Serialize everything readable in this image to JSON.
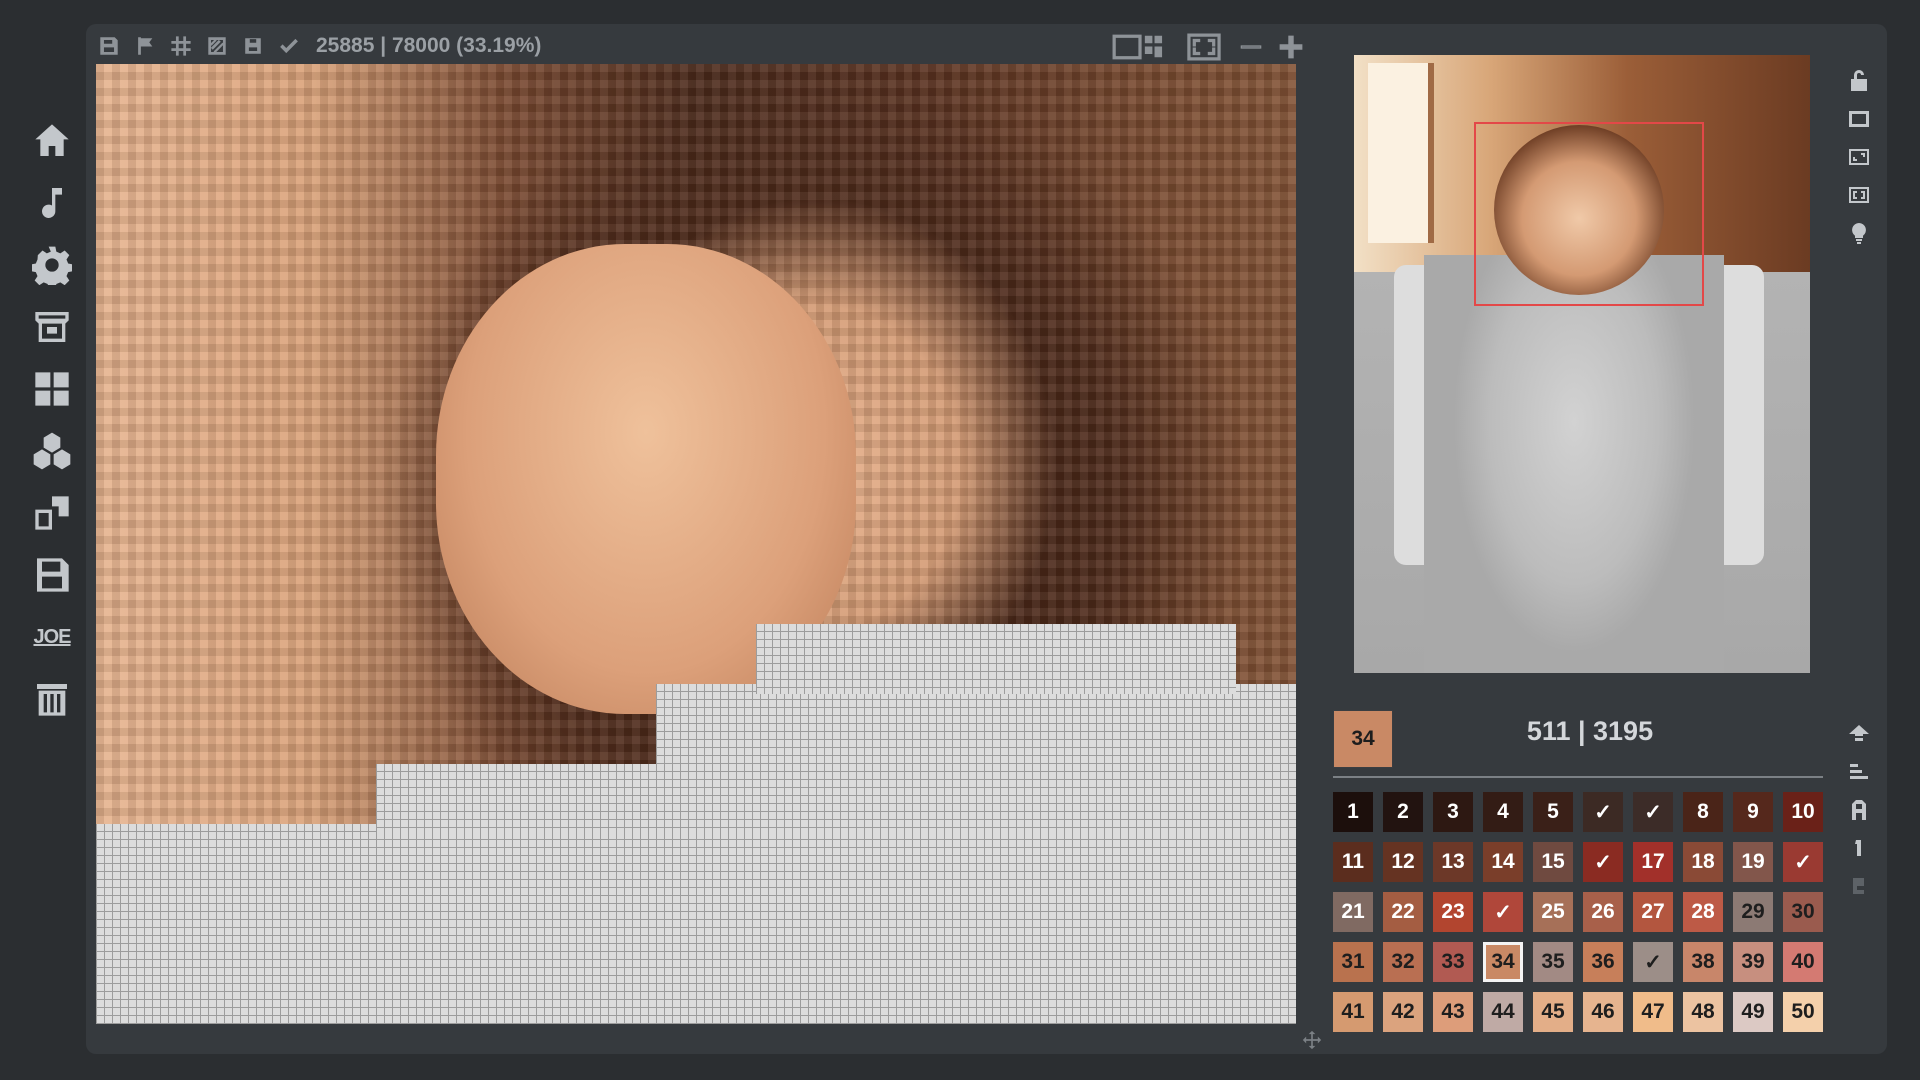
{
  "toolbar": {
    "left_icons": [
      "floppy-icon",
      "flag-icon",
      "grid-icon",
      "hatch-icon",
      "bucket-icon",
      "check-icon"
    ],
    "progress_text": "25885 | 78000 (33.19%)",
    "right_icons": [
      "split-view-icon",
      "fullscreen-icon",
      "zoom-out-icon",
      "zoom-in-icon"
    ]
  },
  "sidebar": {
    "items": [
      {
        "name": "home",
        "icon": "home-icon"
      },
      {
        "name": "music",
        "icon": "music-note-icon"
      },
      {
        "name": "settings",
        "icon": "gear-icon"
      },
      {
        "name": "store",
        "icon": "store-icon"
      },
      {
        "name": "gallery",
        "icon": "grid-icon"
      },
      {
        "name": "cubes",
        "icon": "cubes-icon"
      },
      {
        "name": "transfer",
        "icon": "transfer-icon"
      },
      {
        "name": "save",
        "icon": "save-icon"
      },
      {
        "name": "joe",
        "label": "JOE"
      },
      {
        "name": "delete",
        "icon": "trash-icon"
      }
    ]
  },
  "right_tools_top": [
    "lock-open-icon",
    "frame-icon",
    "expand-icon",
    "fit-icon",
    "bulb-icon"
  ],
  "right_tools_bottom": [
    "up-arrow-icon",
    "sort-icon",
    "font-a-icon",
    "number-1-icon",
    "number-2-icon"
  ],
  "selected": {
    "number": "34",
    "color": "#c98965"
  },
  "counts": "511  |  3195",
  "palette": [
    {
      "label": "1",
      "color": "#1c0f0c"
    },
    {
      "label": "2",
      "color": "#221310"
    },
    {
      "label": "3",
      "color": "#2d1812"
    },
    {
      "label": "4",
      "color": "#331c15"
    },
    {
      "label": "5",
      "color": "#3a2018"
    },
    {
      "label": "✓",
      "color": "#3c2a24"
    },
    {
      "label": "✓",
      "color": "#3c2c28"
    },
    {
      "label": "8",
      "color": "#4a2418"
    },
    {
      "label": "9",
      "color": "#55281c"
    },
    {
      "label": "10",
      "color": "#6a2118"
    },
    {
      "label": "11",
      "color": "#5b2d1e"
    },
    {
      "label": "12",
      "color": "#653322"
    },
    {
      "label": "13",
      "color": "#6c3828"
    },
    {
      "label": "14",
      "color": "#7a3e2a"
    },
    {
      "label": "15",
      "color": "#6f4a40"
    },
    {
      "label": "✓",
      "color": "#8a2b22"
    },
    {
      "label": "17",
      "color": "#a2302a"
    },
    {
      "label": "18",
      "color": "#8a4a36"
    },
    {
      "label": "19",
      "color": "#82564b"
    },
    {
      "label": "✓",
      "color": "#9a3a32"
    },
    {
      "label": "21",
      "color": "#806a62"
    },
    {
      "label": "22",
      "color": "#a45d42"
    },
    {
      "label": "23",
      "color": "#b2452f"
    },
    {
      "label": "✓",
      "color": "#b0473a"
    },
    {
      "label": "25",
      "color": "#a67058"
    },
    {
      "label": "26",
      "color": "#a8604a"
    },
    {
      "label": "27",
      "color": "#b3563f"
    },
    {
      "label": "28",
      "color": "#bd5a46"
    },
    {
      "label": "29",
      "color": "#8c7a74"
    },
    {
      "label": "30",
      "color": "#9a5b4e"
    },
    {
      "label": "31",
      "color": "#b9724e"
    },
    {
      "label": "32",
      "color": "#b96f52"
    },
    {
      "label": "33",
      "color": "#b15a52"
    },
    {
      "label": "34",
      "color": "#c98965"
    },
    {
      "label": "35",
      "color": "#a28a84"
    },
    {
      "label": "36",
      "color": "#c77f5a"
    },
    {
      "label": "✓",
      "color": "#9c8e88"
    },
    {
      "label": "38",
      "color": "#c8866a"
    },
    {
      "label": "39",
      "color": "#c78f7f"
    },
    {
      "label": "40",
      "color": "#d47a72"
    },
    {
      "label": "41",
      "color": "#d59a70"
    },
    {
      "label": "42",
      "color": "#dba37e"
    },
    {
      "label": "43",
      "color": "#dd9d7a"
    },
    {
      "label": "44",
      "color": "#bfaaa5"
    },
    {
      "label": "45",
      "color": "#e3ae88"
    },
    {
      "label": "46",
      "color": "#e6b48f"
    },
    {
      "label": "47",
      "color": "#f0bc8a"
    },
    {
      "label": "48",
      "color": "#ecc3a1"
    },
    {
      "label": "49",
      "color": "#dcc9c4"
    },
    {
      "label": "50",
      "color": "#f4d0ab"
    }
  ],
  "light_text_from": 28
}
